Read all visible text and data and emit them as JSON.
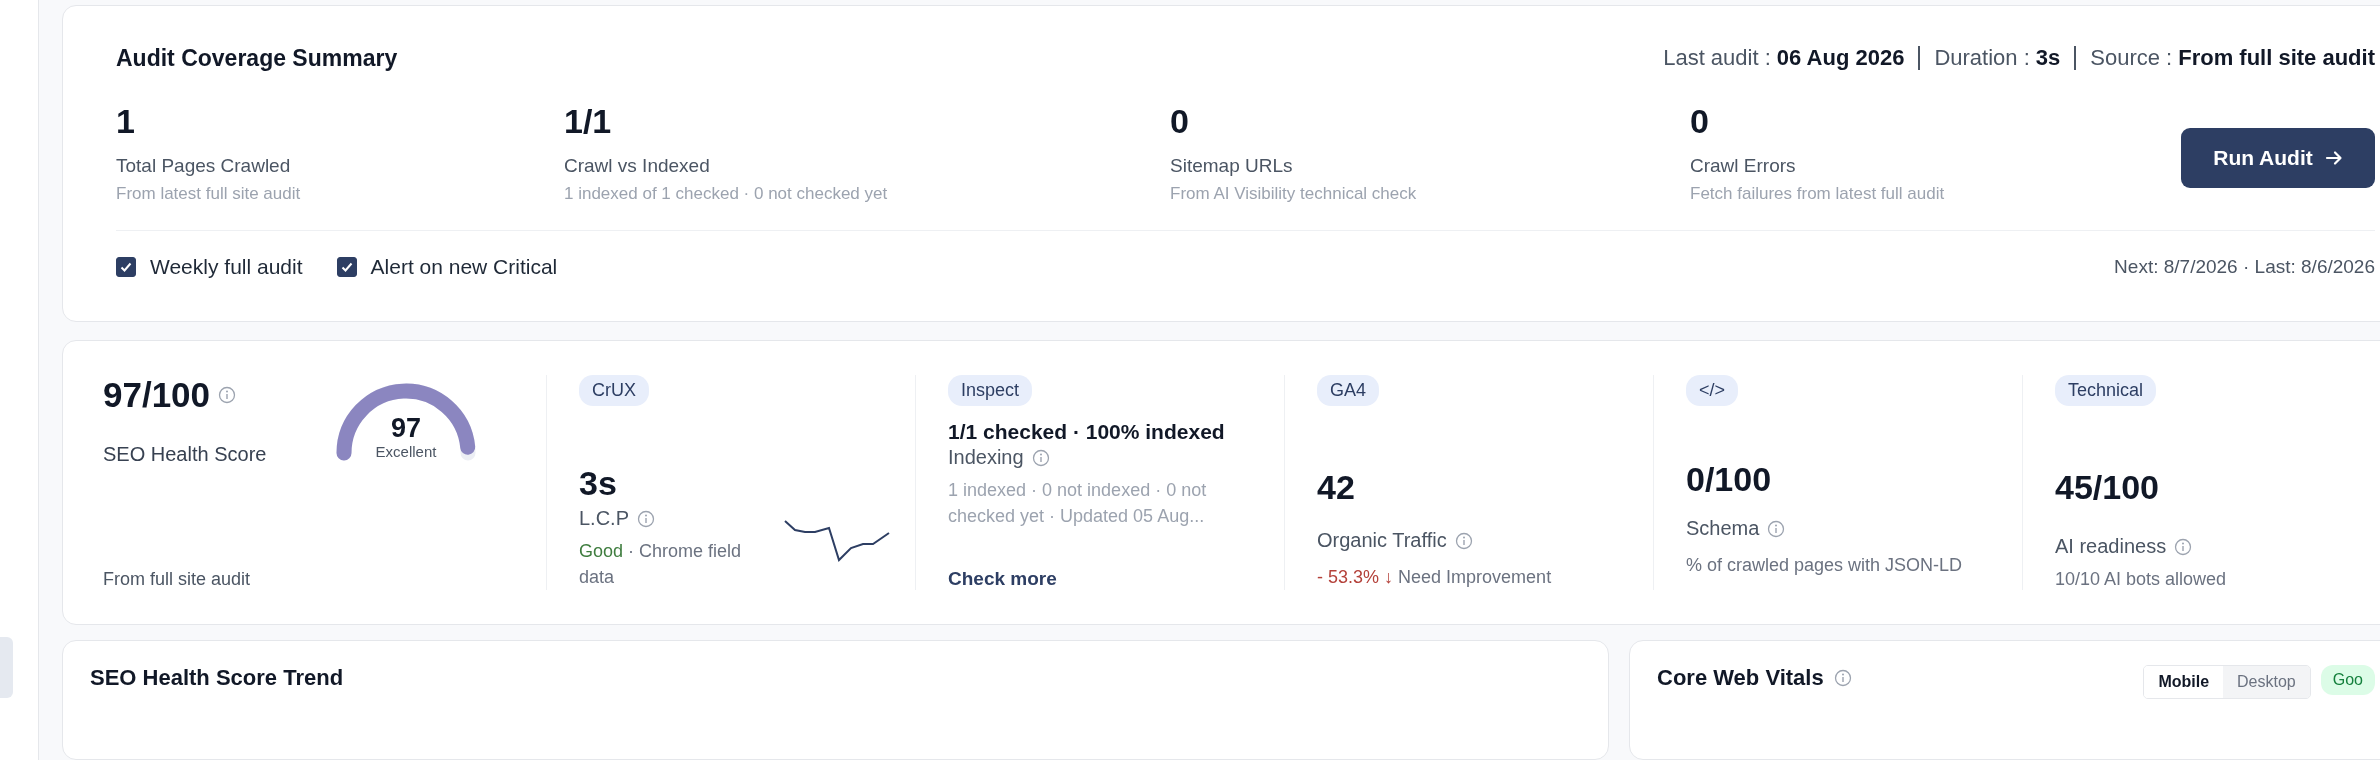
{
  "audit_summary": {
    "title": "Audit Coverage Summary",
    "meta": [
      {
        "label": "Last audit :",
        "value": "06 Aug 2026"
      },
      {
        "label": "Duration :",
        "value": "3s"
      },
      {
        "label": "Source :",
        "value": "From full site audit"
      }
    ],
    "stats": [
      {
        "value": "1",
        "label": "Total Pages Crawled",
        "note": "From latest full site audit"
      },
      {
        "value": "1/1",
        "label": "Crawl vs Indexed",
        "note": "1 indexed of 1 checked · 0 not checked yet"
      },
      {
        "value": "0",
        "label": "Sitemap URLs",
        "note": "From AI Visibility technical check"
      },
      {
        "value": "0",
        "label": "Crawl Errors",
        "note": "Fetch failures from latest full audit"
      }
    ],
    "run_button": "Run Audit",
    "options": [
      {
        "label": "Weekly full audit",
        "checked": true
      },
      {
        "label": "Alert on new Critical",
        "checked": true
      }
    ],
    "schedule": "Next: 8/7/2026 · Last: 8/6/2026"
  },
  "metrics": {
    "health": {
      "score": "97/100",
      "label": "SEO Health Score",
      "gauge_value": "97",
      "gauge_label": "Excellent",
      "level": 0.97,
      "footer": "From full site audit"
    },
    "cards": [
      {
        "kind": "crux",
        "badge": "CrUX",
        "value": "3s",
        "label": "L.C.P",
        "status": "Good",
        "note": "· Chrome field data"
      },
      {
        "kind": "inspect",
        "badge": "Inspect",
        "headline": "1/1 checked · 100% indexed",
        "label": "Indexing",
        "note": "1 indexed · 0 not indexed · 0 not checked yet · Updated 05 Aug...",
        "link": "Check more"
      },
      {
        "kind": "ga4",
        "badge": "GA4",
        "value": "42",
        "label": "Organic Traffic",
        "change": "- 53.3% ↓",
        "note": "Need Improvement"
      },
      {
        "kind": "schema",
        "badge": "</>",
        "value": "0/100",
        "label": "Schema",
        "note": "% of crawled pages with JSON-LD"
      },
      {
        "kind": "technical",
        "badge": "Technical",
        "value": "45/100",
        "label": "AI readiness",
        "note": "10/10 AI bots allowed"
      }
    ]
  },
  "panels": [
    {
      "title": "SEO Health Score Trend"
    },
    {
      "title": "Core Web Vitals",
      "toggle": [
        {
          "label": "Mobile",
          "selected": true
        },
        {
          "label": "Desktop",
          "selected": false
        }
      ],
      "badge": "Goo"
    }
  ]
}
